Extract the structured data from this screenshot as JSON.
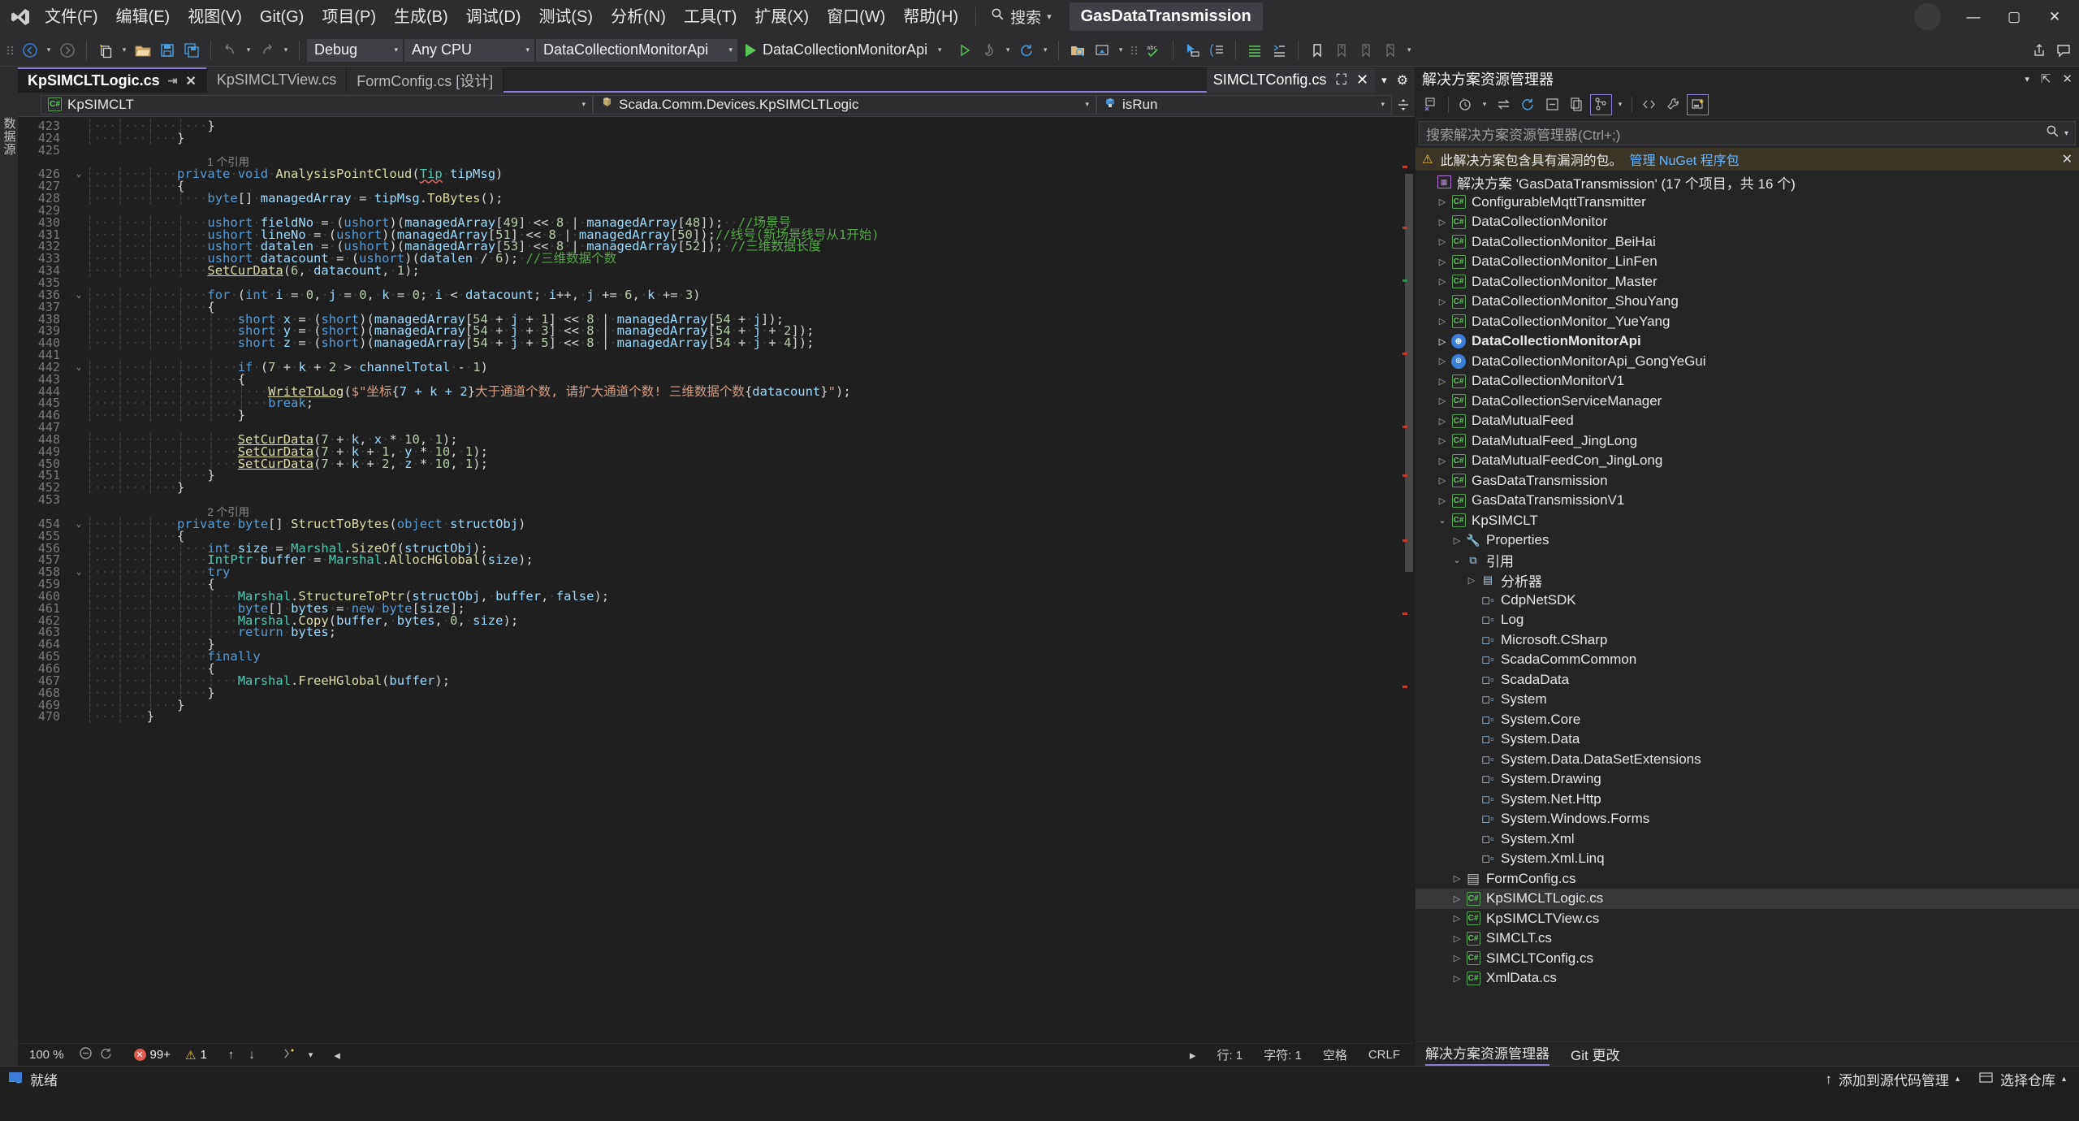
{
  "titlebar": {
    "logo_icon": "visual-studio-logo",
    "menus": [
      "文件(F)",
      "编辑(E)",
      "视图(V)",
      "Git(G)",
      "项目(P)",
      "生成(B)",
      "调试(D)",
      "测试(S)",
      "分析(N)",
      "工具(T)",
      "扩展(X)",
      "窗口(W)",
      "帮助(H)"
    ],
    "search_label": "搜索",
    "solution_name": "GasDataTransmission",
    "window_buttons": [
      "minimize",
      "maximize",
      "close"
    ]
  },
  "toolbar": {
    "config": "Debug",
    "platform": "Any CPU",
    "startup_project": "DataCollectionMonitorApi",
    "run_label": "DataCollectionMonitorApi"
  },
  "left_rail": {
    "vertical_label": "数据源"
  },
  "tabs": [
    {
      "label": "KpSIMCLTLogic.cs",
      "active": true,
      "pinned": true,
      "closable": true
    },
    {
      "label": "KpSIMCLTView.cs",
      "active": false
    },
    {
      "label": "FormConfig.cs [设计]",
      "active": false
    }
  ],
  "tab_right": {
    "label": "SIMCLTConfig.cs"
  },
  "navbar": {
    "project": "KpSIMCLT",
    "type": "Scada.Comm.Devices.KpSIMCLTLogic",
    "member": "isRun"
  },
  "editor": {
    "first_line": 423,
    "lines": [
      {
        "n": 423,
        "indent": 4,
        "text": "}"
      },
      {
        "n": 424,
        "indent": 3,
        "text": "}"
      },
      {
        "n": 425,
        "indent": 0,
        "text": ""
      },
      {
        "n": "",
        "ref": "1 个引用",
        "indent": 3
      },
      {
        "n": 426,
        "fold": "v",
        "indent": 3,
        "text": "private void AnalysisPointCloud(Tip tipMsg)"
      },
      {
        "n": 427,
        "indent": 3,
        "text": "{"
      },
      {
        "n": 428,
        "indent": 4,
        "text": "byte[] managedArray = tipMsg.ToBytes();"
      },
      {
        "n": 429,
        "indent": 0,
        "text": ""
      },
      {
        "n": 430,
        "indent": 4,
        "text": "ushort fieldNo = (ushort)(managedArray[49] << 8 | managedArray[48]);  //场景号"
      },
      {
        "n": 431,
        "indent": 4,
        "text": "ushort lineNo = (ushort)(managedArray[51] << 8 | managedArray[50]);//线号(新场景线号从1开始)"
      },
      {
        "n": 432,
        "indent": 4,
        "text": "ushort datalen = (ushort)(managedArray[53] << 8 | managedArray[52]); //三维数据长度"
      },
      {
        "n": 433,
        "indent": 4,
        "text": "ushort datacount = (ushort)(datalen / 6); //三维数据个数"
      },
      {
        "n": 434,
        "indent": 4,
        "text": "SetCurData(6, datacount, 1);"
      },
      {
        "n": 435,
        "indent": 0,
        "text": ""
      },
      {
        "n": 436,
        "fold": "v",
        "indent": 4,
        "text": "for (int i = 0, j = 0, k = 0; i < datacount; i++, j += 6, k += 3)"
      },
      {
        "n": 437,
        "indent": 4,
        "text": "{"
      },
      {
        "n": 438,
        "indent": 5,
        "text": "short x = (short)(managedArray[54 + j + 1] << 8 | managedArray[54 + j]);"
      },
      {
        "n": 439,
        "indent": 5,
        "text": "short y = (short)(managedArray[54 + j + 3] << 8 | managedArray[54 + j + 2]);"
      },
      {
        "n": 440,
        "indent": 5,
        "text": "short z = (short)(managedArray[54 + j + 5] << 8 | managedArray[54 + j + 4]);"
      },
      {
        "n": 441,
        "indent": 0,
        "text": ""
      },
      {
        "n": 442,
        "fold": "v",
        "indent": 5,
        "text": "if (7 + k + 2 > channelTotal - 1)"
      },
      {
        "n": 443,
        "indent": 5,
        "text": "{"
      },
      {
        "n": 444,
        "indent": 6,
        "text": "WriteToLog($\"坐标{7 + k + 2}大于通道个数, 请扩大通道个数! 三维数据个数{datacount}\");"
      },
      {
        "n": 445,
        "indent": 6,
        "text": "break;"
      },
      {
        "n": 446,
        "indent": 5,
        "text": "}"
      },
      {
        "n": 447,
        "indent": 0,
        "text": ""
      },
      {
        "n": 448,
        "indent": 5,
        "text": "SetCurData(7 + k, x * 10, 1);"
      },
      {
        "n": 449,
        "indent": 5,
        "text": "SetCurData(7 + k + 1, y * 10, 1);"
      },
      {
        "n": 450,
        "indent": 5,
        "text": "SetCurData(7 + k + 2, z * 10, 1);"
      },
      {
        "n": 451,
        "indent": 4,
        "text": "}"
      },
      {
        "n": 452,
        "indent": 3,
        "text": "}"
      },
      {
        "n": 453,
        "indent": 0,
        "text": ""
      },
      {
        "n": "",
        "ref": "2 个引用",
        "indent": 3
      },
      {
        "n": 454,
        "fold": "v",
        "indent": 3,
        "text": "private byte[] StructToBytes(object structObj)"
      },
      {
        "n": 455,
        "indent": 3,
        "text": "{"
      },
      {
        "n": 456,
        "indent": 4,
        "text": "int size = Marshal.SizeOf(structObj);"
      },
      {
        "n": 457,
        "indent": 4,
        "text": "IntPtr buffer = Marshal.AllocHGlobal(size);"
      },
      {
        "n": 458,
        "fold": "v",
        "indent": 4,
        "text": "try"
      },
      {
        "n": 459,
        "indent": 4,
        "text": "{"
      },
      {
        "n": 460,
        "indent": 5,
        "text": "Marshal.StructureToPtr(structObj, buffer, false);"
      },
      {
        "n": 461,
        "indent": 5,
        "text": "byte[] bytes = new byte[size];"
      },
      {
        "n": 462,
        "indent": 5,
        "text": "Marshal.Copy(buffer, bytes, 0, size);"
      },
      {
        "n": 463,
        "indent": 5,
        "text": "return bytes;"
      },
      {
        "n": 464,
        "indent": 4,
        "text": "}"
      },
      {
        "n": 465,
        "indent": 4,
        "text": "finally"
      },
      {
        "n": 466,
        "indent": 4,
        "text": "{"
      },
      {
        "n": 467,
        "indent": 5,
        "text": "Marshal.FreeHGlobal(buffer);"
      },
      {
        "n": 468,
        "indent": 4,
        "text": "}"
      },
      {
        "n": 469,
        "indent": 3,
        "text": "}"
      },
      {
        "n": 470,
        "indent": 2,
        "text": "}"
      }
    ]
  },
  "editor_status": {
    "zoom": "100 %",
    "error_count": "99+",
    "warning_count": "1",
    "line_label": "行: 1",
    "col_label": "字符: 1",
    "spaces_label": "空格",
    "eol_label": "CRLF"
  },
  "solution_explorer": {
    "title": "解决方案资源管理器",
    "search_placeholder": "搜索解决方案资源管理器(Ctrl+;)",
    "warning_text": "此解决方案包含具有漏洞的包。",
    "warning_link": "管理 NuGet 程序包",
    "solution_root": "解决方案 'GasDataTransmission' (17 个项目，共 16 个)",
    "tree": [
      {
        "label": "ConfigurableMqttTransmitter",
        "depth": 1,
        "icon": "csharp-project-icon",
        "expand": "collapsed"
      },
      {
        "label": "DataCollectionMonitor",
        "depth": 1,
        "icon": "csharp-project-icon",
        "expand": "collapsed"
      },
      {
        "label": "DataCollectionMonitor_BeiHai",
        "depth": 1,
        "icon": "csharp-project-icon",
        "expand": "collapsed"
      },
      {
        "label": "DataCollectionMonitor_LinFen",
        "depth": 1,
        "icon": "csharp-project-icon",
        "expand": "collapsed"
      },
      {
        "label": "DataCollectionMonitor_Master",
        "depth": 1,
        "icon": "csharp-project-icon",
        "expand": "collapsed"
      },
      {
        "label": "DataCollectionMonitor_ShouYang",
        "depth": 1,
        "icon": "csharp-project-icon",
        "expand": "collapsed"
      },
      {
        "label": "DataCollectionMonitor_YueYang",
        "depth": 1,
        "icon": "csharp-project-icon",
        "expand": "collapsed"
      },
      {
        "label": "DataCollectionMonitorApi",
        "depth": 1,
        "icon": "web-project-icon",
        "expand": "collapsed",
        "bold": true
      },
      {
        "label": "DataCollectionMonitorApi_GongYeGui",
        "depth": 1,
        "icon": "web-project-icon",
        "expand": "collapsed"
      },
      {
        "label": "DataCollectionMonitorV1",
        "depth": 1,
        "icon": "csharp-project-icon",
        "expand": "collapsed"
      },
      {
        "label": "DataCollectionServiceManager",
        "depth": 1,
        "icon": "csharp-project-icon",
        "expand": "collapsed"
      },
      {
        "label": "DataMutualFeed",
        "depth": 1,
        "icon": "csharp-project-icon",
        "expand": "collapsed"
      },
      {
        "label": "DataMutualFeed_JingLong",
        "depth": 1,
        "icon": "csharp-project-icon",
        "expand": "collapsed"
      },
      {
        "label": "DataMutualFeedCon_JingLong",
        "depth": 1,
        "icon": "csharp-project-icon",
        "expand": "collapsed"
      },
      {
        "label": "GasDataTransmission",
        "depth": 1,
        "icon": "csharp-project-icon",
        "expand": "collapsed"
      },
      {
        "label": "GasDataTransmissionV1",
        "depth": 1,
        "icon": "csharp-project-icon",
        "expand": "collapsed"
      },
      {
        "label": "KpSIMCLT",
        "depth": 1,
        "icon": "csharp-project-icon",
        "expand": "expanded"
      },
      {
        "label": "Properties",
        "depth": 2,
        "icon": "wrench-icon",
        "expand": "collapsed"
      },
      {
        "label": "引用",
        "depth": 2,
        "icon": "references-icon",
        "expand": "expanded"
      },
      {
        "label": "分析器",
        "depth": 3,
        "icon": "analyzer-icon",
        "expand": "collapsed"
      },
      {
        "label": "CdpNetSDK",
        "depth": 3,
        "icon": "reference-icon"
      },
      {
        "label": "Log",
        "depth": 3,
        "icon": "reference-icon"
      },
      {
        "label": "Microsoft.CSharp",
        "depth": 3,
        "icon": "reference-icon"
      },
      {
        "label": "ScadaCommCommon",
        "depth": 3,
        "icon": "reference-icon"
      },
      {
        "label": "ScadaData",
        "depth": 3,
        "icon": "reference-icon"
      },
      {
        "label": "System",
        "depth": 3,
        "icon": "reference-icon"
      },
      {
        "label": "System.Core",
        "depth": 3,
        "icon": "reference-icon"
      },
      {
        "label": "System.Data",
        "depth": 3,
        "icon": "reference-icon"
      },
      {
        "label": "System.Data.DataSetExtensions",
        "depth": 3,
        "icon": "reference-icon"
      },
      {
        "label": "System.Drawing",
        "depth": 3,
        "icon": "reference-icon"
      },
      {
        "label": "System.Net.Http",
        "depth": 3,
        "icon": "reference-icon"
      },
      {
        "label": "System.Windows.Forms",
        "depth": 3,
        "icon": "reference-icon"
      },
      {
        "label": "System.Xml",
        "depth": 3,
        "icon": "reference-icon"
      },
      {
        "label": "System.Xml.Linq",
        "depth": 3,
        "icon": "reference-icon"
      },
      {
        "label": "FormConfig.cs",
        "depth": 2,
        "icon": "form-icon",
        "expand": "collapsed"
      },
      {
        "label": "KpSIMCLTLogic.cs",
        "depth": 2,
        "icon": "csharp-file-icon",
        "expand": "collapsed",
        "selected": true
      },
      {
        "label": "KpSIMCLTView.cs",
        "depth": 2,
        "icon": "csharp-file-icon",
        "expand": "collapsed"
      },
      {
        "label": "SIMCLT.cs",
        "depth": 2,
        "icon": "csharp-file-icon",
        "expand": "collapsed"
      },
      {
        "label": "SIMCLTConfig.cs",
        "depth": 2,
        "icon": "csharp-file-icon",
        "expand": "collapsed"
      },
      {
        "label": "XmlData.cs",
        "depth": 2,
        "icon": "csharp-file-icon",
        "expand": "collapsed"
      }
    ],
    "footer_tabs": [
      "解决方案资源管理器",
      "Git 更改"
    ]
  },
  "statusbar": {
    "ready_label": "就绪",
    "source_control_label": "添加到源代码管理",
    "repo_label": "选择仓库"
  },
  "colors": {
    "accent": "#8a7fd4",
    "keyword": "#569cd6",
    "type": "#4ec9b0",
    "method": "#dcdcaa",
    "string": "#d69d85",
    "number": "#b5cea8",
    "comment": "#57a64a",
    "variable": "#9cdcfe"
  }
}
